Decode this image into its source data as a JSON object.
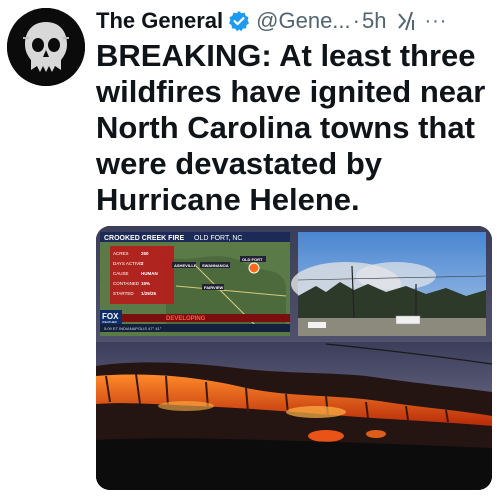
{
  "author": {
    "display_name": "The General",
    "handle": "@Gene...",
    "time_sep": "·",
    "timestamp": "5h",
    "more_label": "···",
    "avatar_icon": "skull-avatar-icon",
    "verified_color": "#1d9bf0"
  },
  "tweet": {
    "text": "BREAKING: At least three wildfires have ignited near North Carolina towns that were devastated by Hurricane Helene."
  },
  "news_graphic": {
    "banner_title": "CROOKED CREEK FIRE",
    "banner_location": "OLD FORT, NC",
    "rows": [
      {
        "label": "ACRES",
        "value": "250"
      },
      {
        "label": "DAYS ACTIVE",
        "value": "2"
      },
      {
        "label": "CAUSE",
        "value": "HUMAN"
      },
      {
        "label": "CONTAINED",
        "value": "15%"
      },
      {
        "label": "STARTED",
        "value": "1/29/25"
      }
    ],
    "map_labels": {
      "old_fort": "OLD FORT",
      "asheville": "ASHEVILLE",
      "swannanoa": "SWANNANOA",
      "fairview": "FAIRVIEW"
    },
    "network_logo": "FOX",
    "network_sub": "WEATHER",
    "ticker_label": "DEVELOPING",
    "ticker_line": "5:09 ET   INDIANAPOLIS   47°  41°"
  },
  "colors": {
    "accent_blue": "#1d9bf0",
    "fire_orange": "#ff6a1a",
    "secondary_text": "#536471"
  }
}
